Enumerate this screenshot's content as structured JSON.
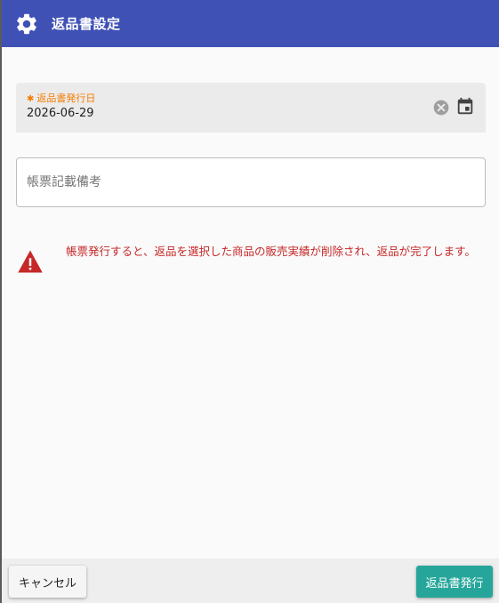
{
  "dialog": {
    "title": "返品書設定",
    "header_icon": "gear-icon",
    "header_color": "#3f51b5"
  },
  "form": {
    "date_field": {
      "required_mark": "✱",
      "label": "返品書発行日",
      "value": "2026-06-29",
      "label_color": "#f57c00",
      "clear_icon": "clear-circle-icon",
      "calendar_icon": "calendar-icon"
    },
    "memo_field": {
      "placeholder": "帳票記載備考",
      "value": ""
    }
  },
  "warning": {
    "icon": "warning-triangle-icon",
    "message": "帳票発行すると、返品を選択した商品の販売実績が削除され、返品が完了します。",
    "color": "#c62828"
  },
  "footer": {
    "cancel_label": "キャンセル",
    "issue_label": "返品書発行",
    "issue_color": "#26a69a"
  }
}
